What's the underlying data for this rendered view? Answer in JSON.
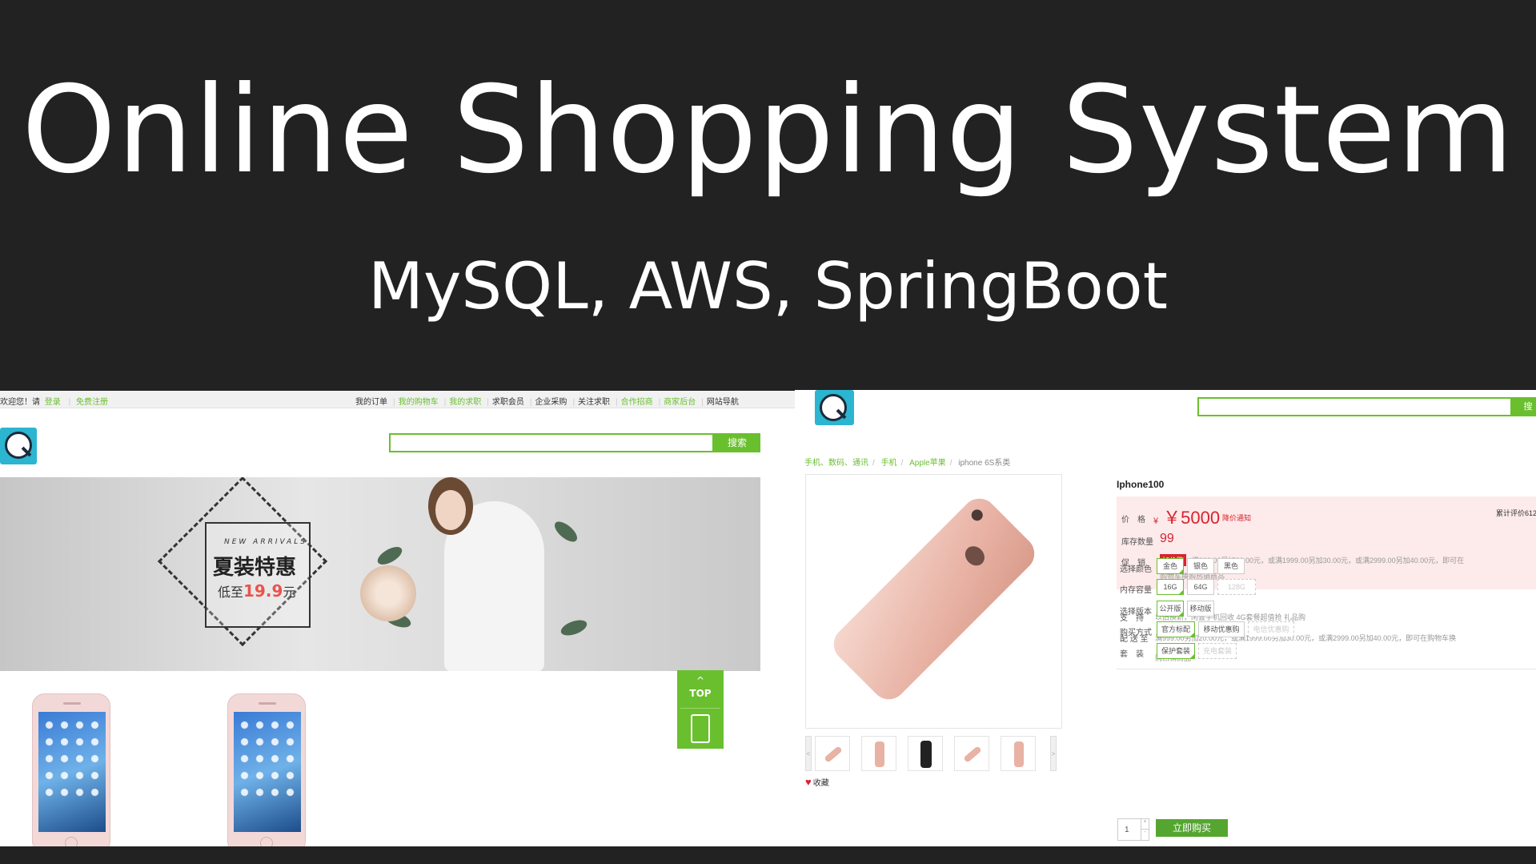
{
  "slide": {
    "title": "Online Shopping System",
    "subtitle": "MySQL, AWS, SpringBoot"
  },
  "store_home": {
    "topbar": {
      "welcome": "欢迎您！请",
      "login": "登录",
      "register": "免费注册",
      "links": [
        {
          "label": "我的订单",
          "color": "#333333"
        },
        {
          "label": "我的购物车",
          "color": "#6abf2e"
        },
        {
          "label": "我的求职",
          "color": "#6abf2e"
        },
        {
          "label": "求职会员",
          "color": "#333333"
        },
        {
          "label": "企业采购",
          "color": "#333333"
        },
        {
          "label": "关注求职",
          "color": "#333333"
        },
        {
          "label": "合作招商",
          "color": "#6abf2e"
        },
        {
          "label": "商家后台",
          "color": "#6abf2e"
        },
        {
          "label": "网站导航",
          "color": "#333333"
        }
      ]
    },
    "search": {
      "button": "搜索",
      "value": ""
    },
    "banner": {
      "tagline": "NEW ARRIVALS",
      "headline": "夏装特惠",
      "price_prefix": "低至",
      "price": "19.9",
      "price_unit": "元"
    },
    "back_to_top": "TOP",
    "accent_color": "#6abf2e"
  },
  "product_page": {
    "search": {
      "button": "搜",
      "value": ""
    },
    "breadcrumb": [
      "手机、数码、通讯",
      "手机",
      "Apple苹果",
      "iphone 6S系类"
    ],
    "product_name": "Iphone100",
    "price_label": "价　格",
    "currency": "¥",
    "price": "￥5000",
    "price_notice": "降价通知",
    "rating": "累计评价612",
    "stock_label": "库存数量",
    "stock": "99",
    "promo_label": "促　销",
    "promo_tag": "加价购",
    "promo_text": "满999.00另加20.00元，或满1999.00另加30.00元，或满2999.00另加40.00元，即可在",
    "promo_text2": "购物车换购热销商品",
    "support_label": "支　持",
    "support_text": "以旧换新，闲置手机回收  4G套餐超值抢  礼品购",
    "delivery_label": "配 送 至",
    "delivery_text": "满999.00另加20.00元，或满1999.00另加30.00元，或满2999.00另加40.00元，即可在购物车换",
    "delivery_text2": "购热销商品",
    "options": [
      {
        "label": "选择颜色",
        "values": [
          {
            "v": "金色",
            "state": "selected"
          },
          {
            "v": "银色",
            "state": "normal"
          },
          {
            "v": "黑色",
            "state": "normal"
          }
        ]
      },
      {
        "label": "内存容量",
        "values": [
          {
            "v": "16G",
            "state": "selected"
          },
          {
            "v": "64G",
            "state": "normal"
          },
          {
            "v": "128G",
            "state": "disabled"
          }
        ]
      },
      {
        "label": "选择版本",
        "values": [
          {
            "v": "公开版",
            "state": "selected"
          },
          {
            "v": "移动版",
            "state": "normal"
          }
        ]
      },
      {
        "label": "购买方式",
        "values": [
          {
            "v": "官方标配",
            "state": "selected"
          },
          {
            "v": "移动优惠购",
            "state": "normal"
          },
          {
            "v": "电信优惠购",
            "state": "disabled"
          }
        ]
      },
      {
        "label": "套　装",
        "values": [
          {
            "v": "保护套装",
            "state": "selected"
          },
          {
            "v": "充电套装",
            "state": "disabled"
          }
        ]
      }
    ],
    "quantity": "1",
    "buy_button": "立即购买",
    "favorite": "收藏",
    "price_color": "#d9232e"
  }
}
